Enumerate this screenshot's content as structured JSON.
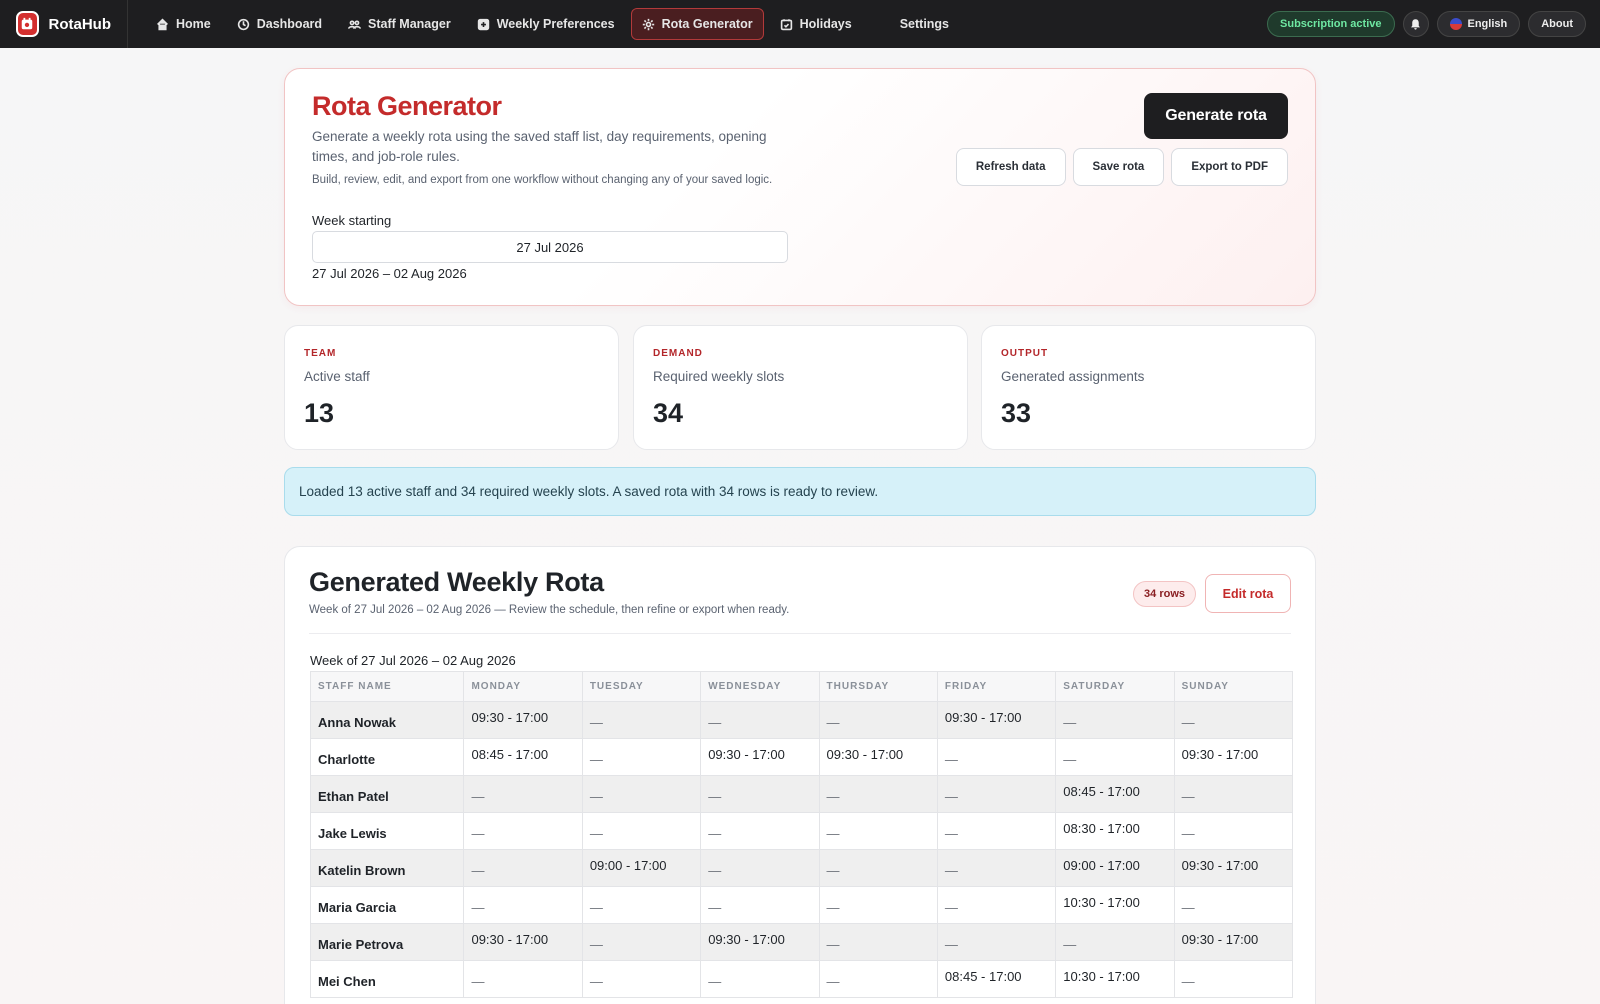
{
  "nav": {
    "brand": "RotaHub",
    "items": [
      {
        "label": "Home",
        "icon": "home-icon"
      },
      {
        "label": "Dashboard",
        "icon": "clock-icon"
      },
      {
        "label": "Staff Manager",
        "icon": "people-icon"
      },
      {
        "label": "Weekly Preferences",
        "icon": "plus-square-icon"
      },
      {
        "label": "Rota Generator",
        "icon": "gear-icon",
        "active": true
      },
      {
        "label": "Holidays",
        "icon": "calendar-check-icon"
      },
      {
        "label": "Settings"
      }
    ],
    "subscription": "Subscription active",
    "language": "English",
    "about": "About"
  },
  "hero": {
    "title": "Rota Generator",
    "description": "Generate a weekly rota using the saved staff list, day requirements, opening times, and job-role rules.",
    "note": "Build, review, edit, and export from one workflow without changing any of your saved logic.",
    "week_label": "Week starting",
    "week_value": "27 Jul 2026",
    "week_range": "27 Jul 2026 – 02 Aug 2026",
    "generate_label": "Generate rota",
    "refresh_label": "Refresh data",
    "save_label": "Save rota",
    "export_label": "Export to PDF"
  },
  "stats": [
    {
      "eyebrow": "TEAM",
      "label": "Active staff",
      "value": "13"
    },
    {
      "eyebrow": "DEMAND",
      "label": "Required weekly slots",
      "value": "34"
    },
    {
      "eyebrow": "OUTPUT",
      "label": "Generated assignments",
      "value": "33"
    }
  ],
  "alert": "Loaded 13 active staff and 34 required weekly slots. A saved rota with 34 rows is ready to review.",
  "rota": {
    "title": "Generated Weekly Rota",
    "subtitle": "Week of 27 Jul 2026 – 02 Aug 2026 — Review the schedule, then refine or export when ready.",
    "rows_badge": "34 rows",
    "edit_label": "Edit rota",
    "caption": "Week of 27 Jul 2026 – 02 Aug 2026",
    "columns": [
      "STAFF NAME",
      "MONDAY",
      "TUESDAY",
      "WEDNESDAY",
      "THURSDAY",
      "FRIDAY",
      "SATURDAY",
      "SUNDAY"
    ],
    "rows": [
      {
        "name": "Anna Nowak",
        "shifts": [
          "09:30 - 17:00",
          "—",
          "—",
          "—",
          "09:30 - 17:00",
          "—",
          "—"
        ]
      },
      {
        "name": "Charlotte",
        "shifts": [
          "08:45 - 17:00",
          "—",
          "09:30 - 17:00",
          "09:30 - 17:00",
          "—",
          "—",
          "09:30 - 17:00"
        ]
      },
      {
        "name": "Ethan Patel",
        "shifts": [
          "—",
          "—",
          "—",
          "—",
          "—",
          "08:45 - 17:00",
          "—"
        ]
      },
      {
        "name": "Jake Lewis",
        "shifts": [
          "—",
          "—",
          "—",
          "—",
          "—",
          "08:30 - 17:00",
          "—"
        ]
      },
      {
        "name": "Katelin Brown",
        "shifts": [
          "—",
          "09:00 - 17:00",
          "—",
          "—",
          "—",
          "09:00 - 17:00",
          "09:30 - 17:00"
        ]
      },
      {
        "name": "Maria Garcia",
        "shifts": [
          "—",
          "—",
          "—",
          "—",
          "—",
          "10:30 - 17:00",
          "—"
        ]
      },
      {
        "name": "Marie Petrova",
        "shifts": [
          "09:30 - 17:00",
          "—",
          "09:30 - 17:00",
          "—",
          "—",
          "—",
          "09:30 - 17:00"
        ]
      },
      {
        "name": "Mei Chen",
        "shifts": [
          "—",
          "—",
          "—",
          "—",
          "08:45 - 17:00",
          "10:30 - 17:00",
          "—"
        ]
      }
    ]
  }
}
